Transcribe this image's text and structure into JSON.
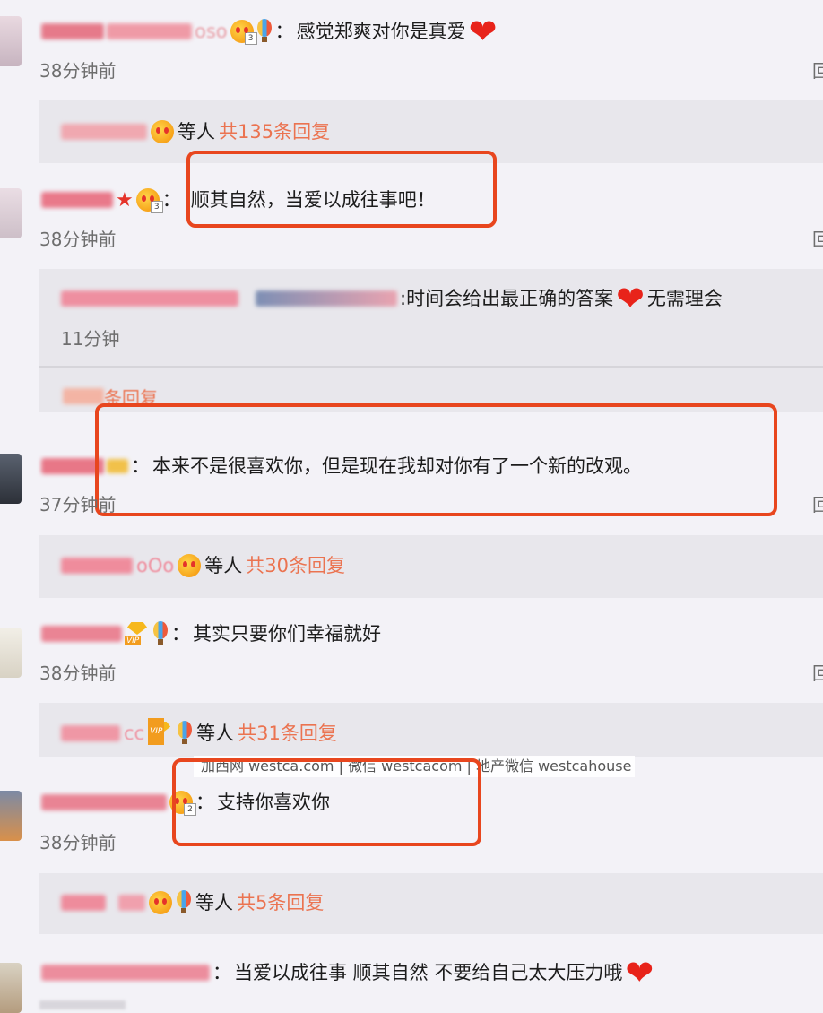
{
  "comments": [
    {
      "text": "感觉郑爽对你是真爱",
      "time": "38分钟前"
    },
    {
      "text": "顺其自然，当爱以成往事吧！",
      "time": "38分钟前"
    },
    {
      "text": "本来不是很喜欢你，但是现在我却对你有了一个新的改观。",
      "time": "37分钟前"
    },
    {
      "text": "其实只要你们幸福就好",
      "time": "38分钟前"
    },
    {
      "text": "支持你喜欢你",
      "time": "38分钟前"
    },
    {
      "text": "当爱以成往事 顺其自然 不要给自己太大压力哦",
      "time": ""
    }
  ],
  "reply_summaries": [
    {
      "prefix": "等人",
      "count_text": "共135条回复"
    },
    {
      "prefix": "等人",
      "count_text": "共30条回复"
    },
    {
      "prefix": "等人",
      "count_text": "共31条回复"
    },
    {
      "prefix": "等人",
      "count_text": "共5条回复"
    }
  ],
  "nested_reply": {
    "text": ":时间会给出最正确的答案",
    "suffix": "无需理会",
    "time": "11分钟",
    "more": "条回复"
  },
  "name_fragments": {
    "c1": "oso",
    "c4": "oOo",
    "c5": "cc"
  },
  "colon": "：",
  "reply_glyph": "回",
  "watermark": "加西网 westca.com | 微信 westcacom | 地产微信 westcahouse",
  "colors": {
    "accent": "#eb7350",
    "highlight_box": "#e8461e",
    "background": "#f3f2f7",
    "reply_bg": "#e8e7ec"
  },
  "icons": [
    "crown-badge-icon",
    "balloon-icon",
    "vip-diamond-icon",
    "heart-icon",
    "red-star-icon"
  ]
}
